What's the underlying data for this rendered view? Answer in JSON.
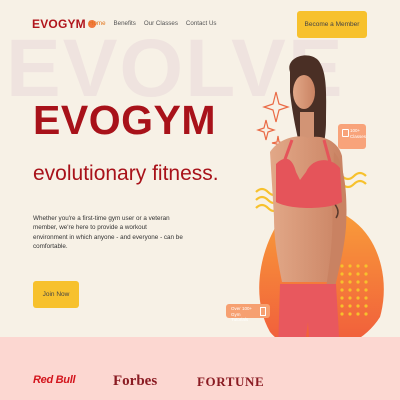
{
  "nav": {
    "logo": "EVOGYM",
    "links": [
      "Home",
      "Benefits",
      "Our Classes",
      "Contact Us"
    ],
    "active": "Home",
    "cta": "Become a Member"
  },
  "hero": {
    "background_word": "EVOLVE",
    "title": "EVOGYM",
    "subtitle": "evolutionary fitness.",
    "text": "Whether you're a first-time gym user or a veteran member, we're here to provide a workout environment in which anyone - and everyone - can be comfortable.",
    "button": "Join Now"
  },
  "badges": {
    "classes": "100+ Classes",
    "tutorials": "Over 100+ Gym Tutorials"
  },
  "sponsors": [
    "Red Bull",
    "Forbes",
    "FORTUNE"
  ],
  "colors": {
    "brand_red": "#a8121a",
    "accent_yellow": "#f7c12d",
    "accent_orange": "#f27a3f",
    "background": "#f7f1e6",
    "sponsor_bar": "#fcd7d1"
  }
}
